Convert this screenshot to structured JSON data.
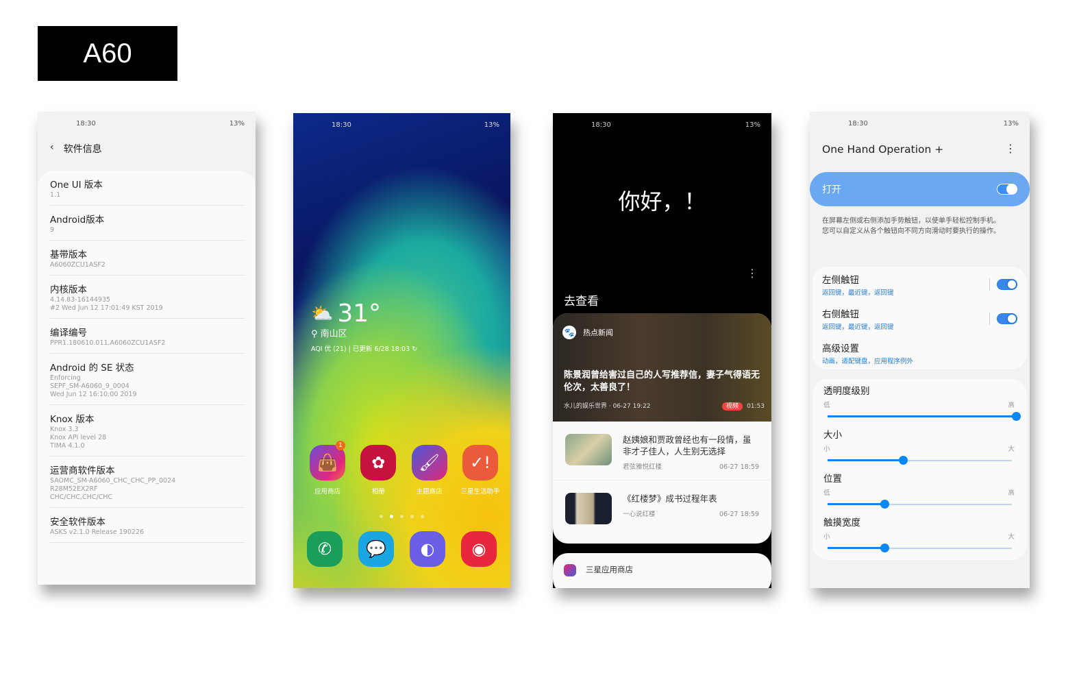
{
  "label": "A60",
  "status": {
    "time": "18:30",
    "battery": "13%"
  },
  "software_info": {
    "title": "软件信息",
    "items": [
      {
        "title": "One UI 版本",
        "value": "1.1"
      },
      {
        "title": "Android版本",
        "value": "9"
      },
      {
        "title": "基带版本",
        "value": "A6060ZCU1ASF2"
      },
      {
        "title": "内核版本",
        "value": "4.14.83-16144935\n#2 Wed Jun 12 17:01:49 KST 2019"
      },
      {
        "title": "编译编号",
        "value": "PPR1.180610.011.A6060ZCU1ASF2"
      },
      {
        "title": "Android 的 SE 状态",
        "value": "Enforcing\nSEPF_SM-A6060_9_0004\nWed Jun 12 16:10:00 2019"
      },
      {
        "title": "Knox 版本",
        "value": "Knox 3.3\nKnox API level 28\nTIMA 4.1.0"
      },
      {
        "title": "运营商软件版本",
        "value": "SAOMC_SM-A6060_CHC_CHC_PP_0024\nR28M52EX2RF\nCHC/CHC,CHC/CHC"
      },
      {
        "title": "安全软件版本",
        "value": "ASKS v2.1.0 Release 190226"
      }
    ]
  },
  "home": {
    "temperature": "31°",
    "location": "南山区",
    "aqi": "AQI 优 (21) | 已更新 6/28 18:03",
    "apps": [
      {
        "label": "应用商店",
        "badge": "1",
        "icon": "shopping-bag-icon",
        "color": "#c2479a"
      },
      {
        "label": "相册",
        "icon": "flower-icon",
        "color": "#c5123e"
      },
      {
        "label": "主题商店",
        "icon": "paintbrush-icon",
        "color": "#7c4bd0"
      },
      {
        "label": "三星生活助手",
        "icon": "checkmark-icon",
        "color": "#ec5a3c"
      }
    ],
    "dock": [
      {
        "icon": "phone-icon",
        "color": "#1a9e5a"
      },
      {
        "icon": "messages-icon",
        "color": "#1aa6e0"
      },
      {
        "icon": "internet-icon",
        "color": "#6a5ee6"
      },
      {
        "icon": "camera-icon",
        "color": "#e8263e"
      }
    ]
  },
  "bixby": {
    "greeting": "你好，！",
    "section": "去查看",
    "news_source": "热点新闻",
    "hero": {
      "headline": "陈景润曾给害过自己的人写推荐信，妻子气得语无伦次，太善良了！",
      "meta": "水儿的娱乐世界 · 06-27 19:22",
      "tag": "视频",
      "duration": "01:53"
    },
    "items": [
      {
        "title": "赵姨娘和贾政曾经也有一段情，虽非才子佳人，人生别无选择",
        "source": "君弦雅悦红楼",
        "time": "06-27 18:59"
      },
      {
        "title": "《红楼梦》成书过程年表",
        "source": "一心说红楼",
        "time": "06-27 18:59"
      }
    ],
    "store": "三星应用商店"
  },
  "one_hand": {
    "title": "One Hand Operation +",
    "master_label": "打开",
    "master_on": true,
    "description": "在屏幕左侧或右侧添加手势触钮，以使单手轻松控制手机。\n您可以自定义从各个触钮向不同方向滑动时要执行的操作。",
    "settings": [
      {
        "title": "左侧触钮",
        "sub": "返回键，最近键，返回键",
        "on": true
      },
      {
        "title": "右侧触钮",
        "sub": "返回键，最近键，返回键",
        "on": true
      },
      {
        "title": "高级设置",
        "sub": "动画，适配键盘，应用程序例外"
      }
    ],
    "sliders": [
      {
        "title": "透明度级别",
        "min": "低",
        "max": "高",
        "value": 100
      },
      {
        "title": "大小",
        "min": "小",
        "max": "大",
        "value": 40
      },
      {
        "title": "位置",
        "min": "低",
        "max": "高",
        "value": 30
      },
      {
        "title": "触摸宽度",
        "min": "小",
        "max": "大",
        "value": 30
      }
    ]
  }
}
